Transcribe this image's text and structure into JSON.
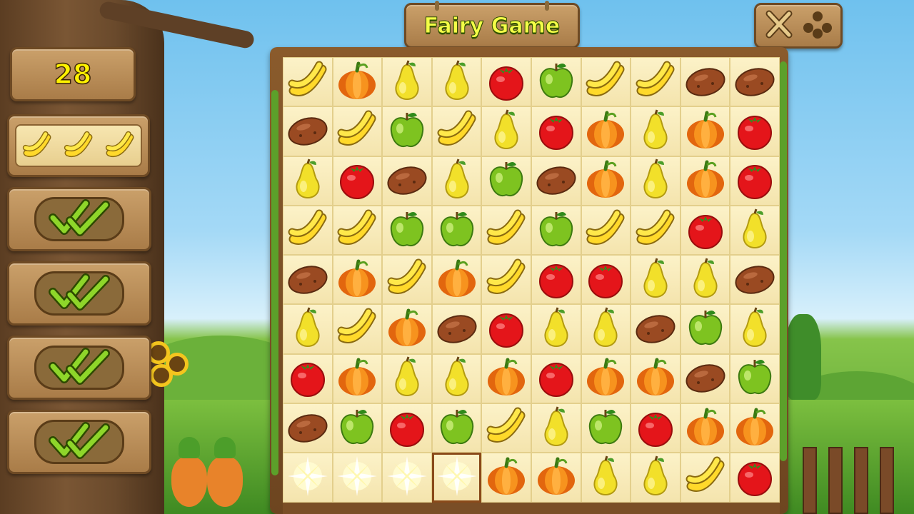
{
  "title": "Fairy Game",
  "score": "28",
  "goal": {
    "fruit": "banana",
    "count": 3
  },
  "objectives": [
    {
      "status": "complete",
      "icon": "double-check-icon"
    },
    {
      "status": "complete",
      "icon": "double-check-icon"
    },
    {
      "status": "complete",
      "icon": "double-check-icon"
    },
    {
      "status": "complete",
      "icon": "double-check-icon"
    }
  ],
  "menu_icon": "close-and-dots-icon",
  "board": {
    "columns": 10,
    "rows": 9,
    "selected": {
      "row": 8,
      "col": 3
    },
    "grid": [
      [
        "banana",
        "pumpkin",
        "pear",
        "pear",
        "tomato",
        "apple",
        "banana",
        "banana",
        "potato",
        "potato"
      ],
      [
        "potato",
        "banana",
        "apple",
        "banana",
        "pear",
        "tomato",
        "pumpkin",
        "pear",
        "pumpkin",
        "tomato"
      ],
      [
        "pear",
        "tomato",
        "potato",
        "pear",
        "apple",
        "potato",
        "pumpkin",
        "pear",
        "pumpkin",
        "tomato"
      ],
      [
        "banana",
        "banana",
        "apple",
        "apple",
        "banana",
        "apple",
        "banana",
        "banana",
        "tomato",
        "pear"
      ],
      [
        "potato",
        "pumpkin",
        "banana",
        "pumpkin",
        "banana",
        "tomato",
        "tomato",
        "pear",
        "pear",
        "potato"
      ],
      [
        "pear",
        "banana",
        "pumpkin",
        "potato",
        "tomato",
        "pear",
        "pear",
        "potato",
        "apple",
        "pear"
      ],
      [
        "tomato",
        "pumpkin",
        "pear",
        "pear",
        "pumpkin",
        "tomato",
        "pumpkin",
        "pumpkin",
        "potato",
        "apple"
      ],
      [
        "potato",
        "apple",
        "tomato",
        "apple",
        "banana",
        "pear",
        "apple",
        "tomato",
        "pumpkin",
        "pumpkin"
      ],
      [
        "sparkle",
        "sparkle",
        "sparkle",
        "sparkle",
        "pumpkin",
        "pumpkin",
        "pear",
        "pear",
        "banana",
        "tomato"
      ]
    ]
  },
  "colors": {
    "title_text": "#f4ff47",
    "score_text": "#fff200",
    "wood": "#a97c48",
    "tile": "#f4e4ad",
    "check": "#8ed62a"
  }
}
